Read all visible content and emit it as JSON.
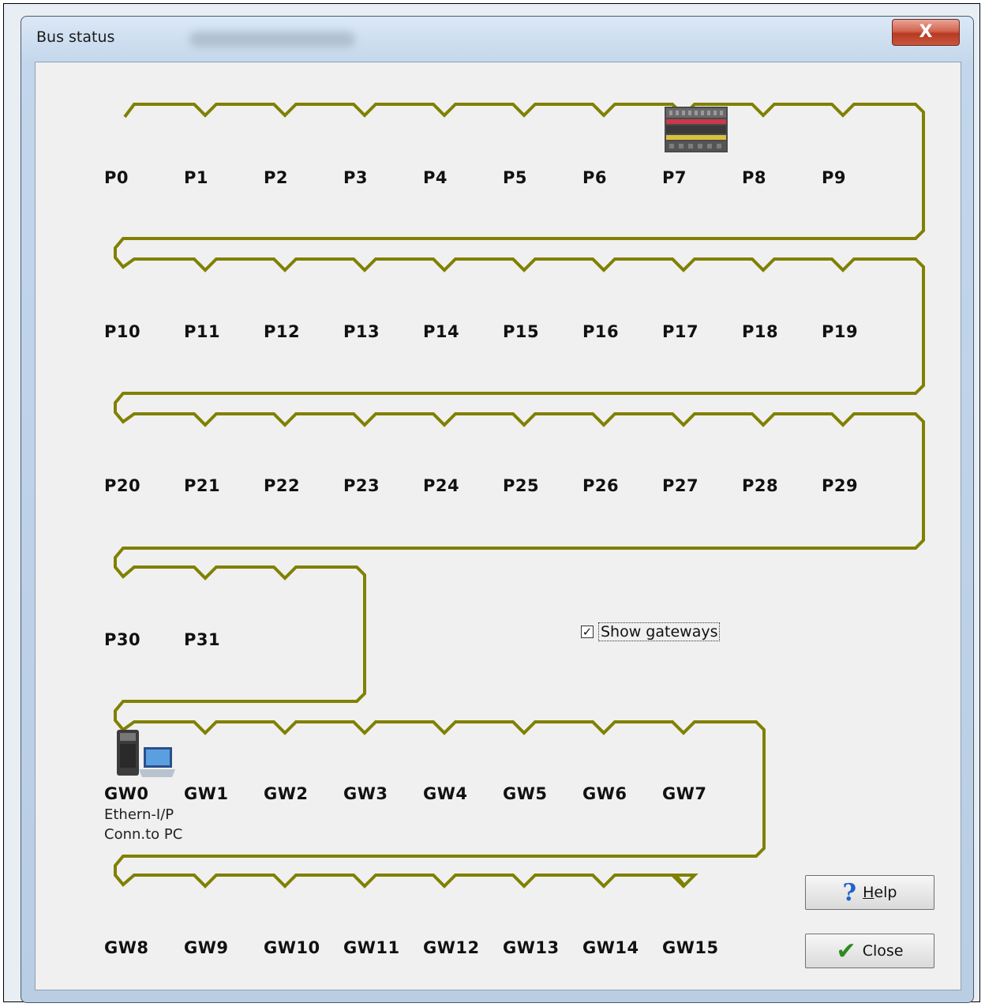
{
  "window": {
    "title": "Bus status",
    "close_glyph": "X"
  },
  "bus_color": "#808000",
  "nodes": {
    "row0": [
      "P0",
      "P1",
      "P2",
      "P3",
      "P4",
      "P5",
      "P6",
      "P7",
      "P8",
      "P9"
    ],
    "row1": [
      "P10",
      "P11",
      "P12",
      "P13",
      "P14",
      "P15",
      "P16",
      "P17",
      "P18",
      "P19"
    ],
    "row2": [
      "P20",
      "P21",
      "P22",
      "P23",
      "P24",
      "P25",
      "P26",
      "P27",
      "P28",
      "P29"
    ],
    "row3": [
      "P30",
      "P31"
    ],
    "gw_row0": [
      "GW0",
      "GW1",
      "GW2",
      "GW3",
      "GW4",
      "GW5",
      "GW6",
      "GW7"
    ],
    "gw_row1": [
      "GW8",
      "GW9",
      "GW10",
      "GW11",
      "GW12",
      "GW13",
      "GW14",
      "GW15"
    ]
  },
  "gw0_details": {
    "line1": "Ethern-I/P",
    "line2": "Conn.to PC"
  },
  "devices": {
    "p7": "plc-module-icon",
    "gw0": "pc-connection-icon"
  },
  "show_gateways": {
    "label": "Show gateways",
    "checked": true,
    "check_glyph": "✓"
  },
  "buttons": {
    "help_label_u": "H",
    "help_label_rest": "elp",
    "help_icon": "?",
    "close_label": "Close",
    "close_icon": "✔"
  }
}
